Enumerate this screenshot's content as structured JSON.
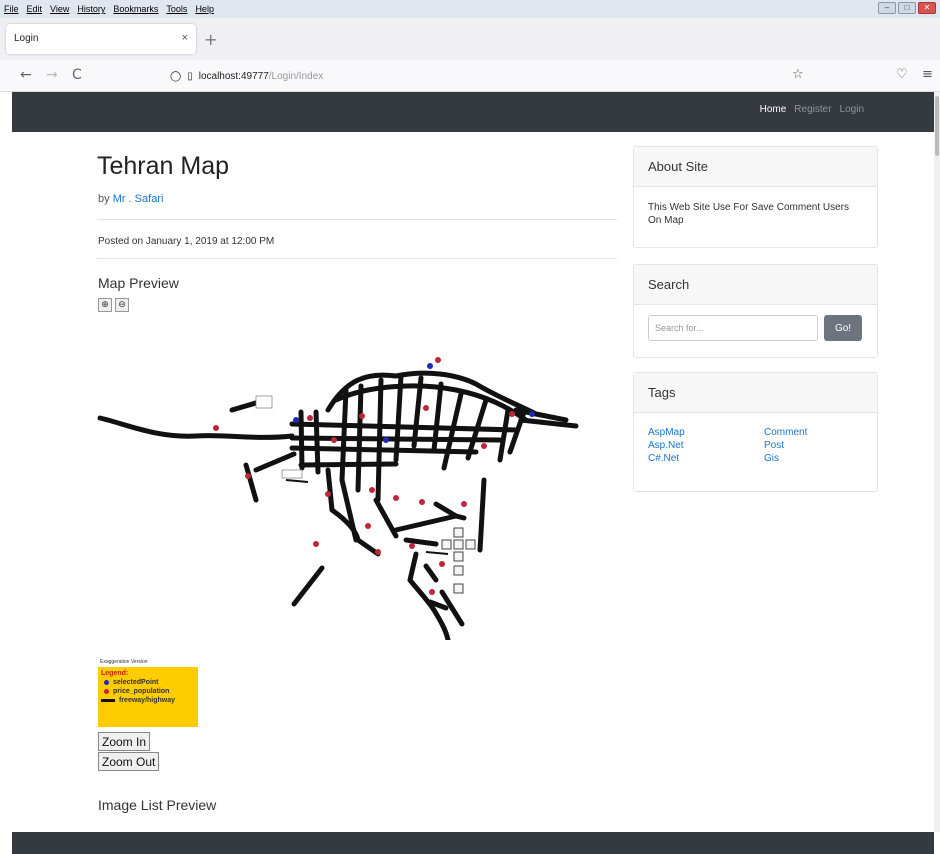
{
  "browser": {
    "menu": [
      "File",
      "Edit",
      "View",
      "History",
      "Bookmarks",
      "Tools",
      "Help"
    ],
    "tab_title": "Login",
    "tab_close": "×",
    "new_tab": "+",
    "url_host": "localhost:49777",
    "url_path": "/Login/Index",
    "nav_back": "←",
    "nav_forward": "→",
    "nav_reload": "C",
    "bookmark_star": "☆",
    "pocket": "♡",
    "menu_button": "≡"
  },
  "site_nav": {
    "links": [
      {
        "label": "Home",
        "active": true
      },
      {
        "label": "Register",
        "active": false
      },
      {
        "label": "Login",
        "active": false
      }
    ]
  },
  "post": {
    "title": "Tehran Map",
    "by_prefix": "by",
    "author": "Mr . Safari",
    "posted": "Posted on January 1, 2019 at 12:00 PM",
    "map_preview_heading": "Map Preview",
    "zoom_in_label": "Zoom In",
    "zoom_out_label": "Zoom Out",
    "image_list_heading": "Image List Preview"
  },
  "map": {
    "scale_text": "Exaggeration Version",
    "legend_title": "Legend:",
    "legend_items": [
      {
        "label": "selectedPoint",
        "color": "#1f2bb5",
        "kind": "dot"
      },
      {
        "label": "price_population",
        "color": "#c0263a",
        "kind": "dot"
      },
      {
        "label": "freeway/highway",
        "color": "#111111",
        "kind": "line"
      }
    ],
    "colors": {
      "road": "#111111",
      "blue_point": "#1f2bb5",
      "red_point": "#c0263a",
      "legend_bg": "#ffcc00"
    }
  },
  "sidebar": {
    "about": {
      "heading": "About Site",
      "text": "This Web Site Use For Save Comment Users On Map"
    },
    "search": {
      "heading": "Search",
      "placeholder": "Search for...",
      "button": "Go!"
    },
    "tags": {
      "heading": "Tags",
      "items": [
        "AspMap",
        "Comment",
        "Asp.Net",
        "Post",
        "C#.Net",
        "Gis"
      ]
    }
  },
  "colors": {
    "navbar": "#343a40",
    "link": "#1a73c9",
    "button": "#6c757d"
  }
}
